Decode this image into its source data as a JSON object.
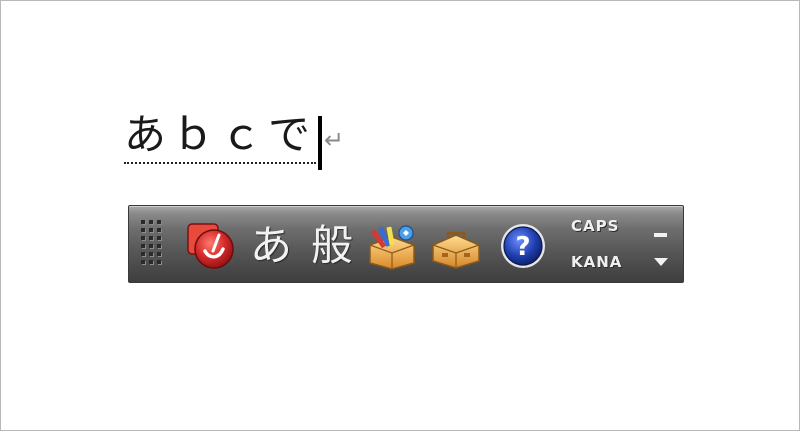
{
  "composition": {
    "text": "あｂｃで",
    "return_mark": "↵"
  },
  "langbar": {
    "input_mode_glyph": "あ",
    "conversion_mode_glyph": "般",
    "status": {
      "caps": "CAPS",
      "kana": "KANA"
    },
    "icons": {
      "ime": "ime-brush-icon",
      "pad": "ime-pad-icon",
      "tools": "toolbox-icon",
      "help": "help-icon",
      "minimize": "minimize-icon",
      "options": "options-arrow-icon"
    },
    "colors": {
      "bar_top": "#a9a9a9",
      "bar_bottom": "#3e3e3e",
      "ime_icon_red": "#d42a2a",
      "help_blue": "#1f3fae",
      "box_orange": "#e9a43a"
    }
  }
}
